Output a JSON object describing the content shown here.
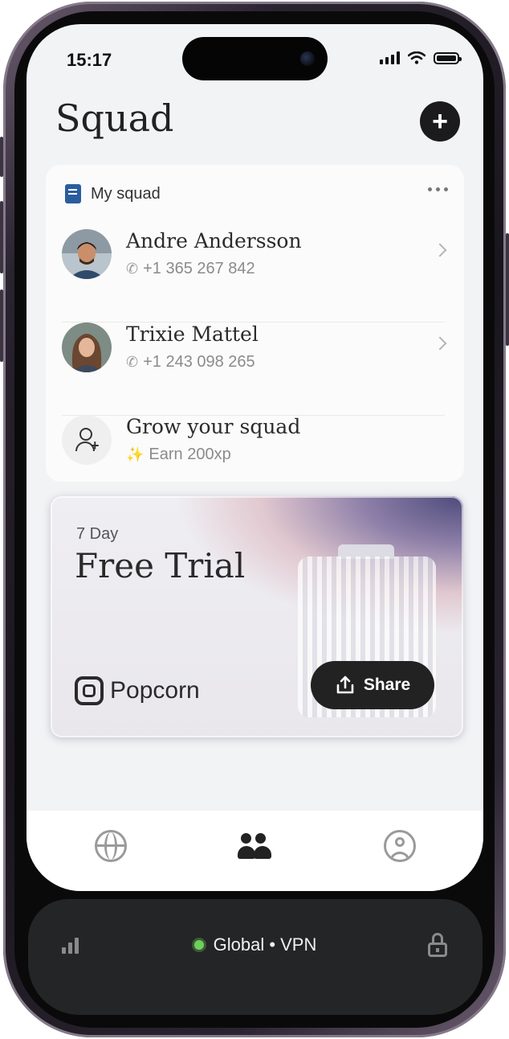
{
  "status_bar": {
    "time": "15:17"
  },
  "header": {
    "title": "Squad",
    "add_label": "+"
  },
  "squad_card": {
    "title": "My squad",
    "members": [
      {
        "name": "Andre Andersson",
        "phone": "+1 365 267 842"
      },
      {
        "name": "Trixie Mattel",
        "phone": "+1 243 098 265"
      }
    ],
    "grow": {
      "title": "Grow your squad",
      "reward": "Earn 200xp"
    }
  },
  "trial_card": {
    "kicker": "7 Day",
    "title": "Free Trial",
    "brand": "Popcorn",
    "share_label": "Share"
  },
  "tab_bar": {
    "active": "squad",
    "tabs": [
      "explore",
      "squad",
      "profile"
    ]
  },
  "vpn_bar": {
    "label": "Global • VPN",
    "status_color": "#6cd05a"
  },
  "icons": [
    "book-icon",
    "more-icon",
    "phone-icon",
    "chevron-right-icon",
    "add-user-icon",
    "sparkle-icon",
    "share-icon",
    "globe-icon",
    "people-icon",
    "profile-icon",
    "signal-icon",
    "lock-icon",
    "wifi-icon",
    "battery-icon"
  ]
}
